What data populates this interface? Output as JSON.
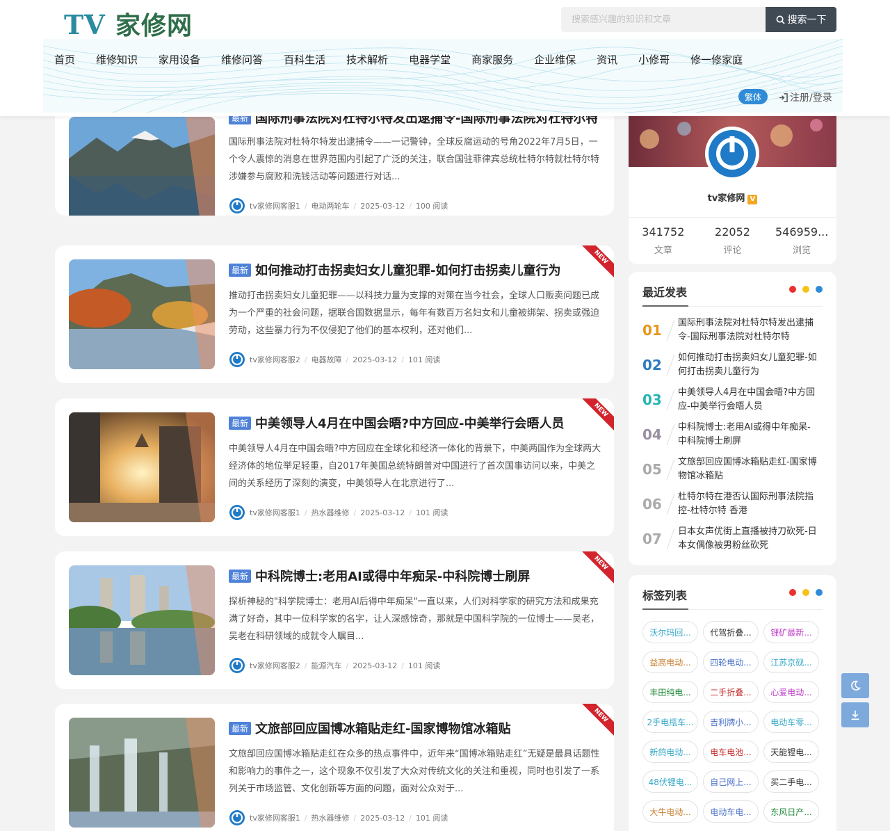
{
  "header": {
    "logo_a": "TV",
    "logo_b": "家修网",
    "search_placeholder": "搜索感兴趣的知识和文章",
    "search_button": "搜索一下",
    "nav": [
      "首页",
      "维修知识",
      "家用设备",
      "维修问答",
      "百科生活",
      "技术解析",
      "电器学堂",
      "商家服务",
      "企业维保",
      "资讯",
      "小修哥",
      "修一修家庭"
    ],
    "traditional": "繁体",
    "login": "注册/登录"
  },
  "articles": [
    {
      "badge": "最新",
      "title": "国际刑事法院对杜特尔特发出逮捕令-国际刑事法院对杜特尔特",
      "excerpt": "国际刑事法院对杜特尔特发出逮捕令——一记警钟，全球反腐运动的号角2022年7月5日，一个令人震惊的消息在世界范围内引起了广泛的关注，联合国驻菲律宾总统杜特尔特就杜特尔特涉嫌参与腐败和洗钱活动等问题进行对话...",
      "author": "tv家修网客服1",
      "category": "电动两轮车",
      "date": "2025-03-12",
      "views": "100 阅读",
      "ribbon": ""
    },
    {
      "badge": "最新",
      "title": "如何推动打击拐卖妇女儿童犯罪-如何打击拐卖儿童行为",
      "excerpt": "推动打击拐卖妇女儿童犯罪——以科技力量为支撑的对策在当今社会，全球人口贩卖问题已成为一个严重的社会问题，据联合国数据显示，每年有数百万名妇女和儿童被绑架、拐卖或强迫劳动，这些暴力行为不仅侵犯了他们的基本权利，还对他们...",
      "author": "tv家修网客服2",
      "category": "电器故障",
      "date": "2025-03-12",
      "views": "101 阅读",
      "ribbon": "NEW"
    },
    {
      "badge": "最新",
      "title": "中美领导人4月在中国会晤?中方回应-中美举行会晤人员",
      "excerpt": "中美领导人4月在中国会晤?中方回应在全球化和经济一体化的背景下，中美两国作为全球两大经济体的地位举足轻重，自2017年美国总统特朗普对中国进行了首次国事访问以来，中美之间的关系经历了深刻的演变，中美领导人在北京进行了...",
      "author": "tv家修网客服1",
      "category": "热水器维修",
      "date": "2025-03-12",
      "views": "101 阅读",
      "ribbon": "NEW"
    },
    {
      "badge": "最新",
      "title": "中科院博士:老用AI或得中年痴呆-中科院博士刷屏",
      "excerpt": "探析神秘的\"科学院博士：老用AI后得中年痴呆\"一直以来，人们对科学家的研究方法和成果充满了好奇，其中一位科学家的名字，让人深感惊奇，那就是中国科学院的一位博士——吴老，吴老在科研领域的成就令人瞩目...",
      "author": "tv家修网客服2",
      "category": "能源汽车",
      "date": "2025-03-12",
      "views": "101 阅读",
      "ribbon": "NEW"
    },
    {
      "badge": "最新",
      "title": "文旅部回应国博冰箱贴走红-国家博物馆冰箱贴",
      "excerpt": "文旅部回应国博冰箱贴走红在众多的热点事件中，近年来“国博冰箱贴走红”无疑是最具话题性和影响力的事件之一，这个现象不仅引发了大众对传统文化的关注和重视，同时也引发了一系列关于市场监管、文化创新等方面的问题，面对公众对于...",
      "author": "tv家修网客服1",
      "category": "热水器维修",
      "date": "2025-03-12",
      "views": "101 阅读",
      "ribbon": "NEW"
    }
  ],
  "profile": {
    "name": "tv家修网",
    "verified": "V",
    "stats": [
      {
        "value": "341752",
        "label": "文章"
      },
      {
        "value": "22052",
        "label": "评论"
      },
      {
        "value": "546959...",
        "label": "浏览"
      }
    ]
  },
  "recent": {
    "title": "最近发表",
    "items": [
      {
        "num": "01",
        "color": "#e8961a",
        "text": "国际刑事法院对杜特尔特发出逮捕令-国际刑事法院对杜特尔特"
      },
      {
        "num": "02",
        "color": "#2b7bc1",
        "text": "如何推动打击拐卖妇女儿童犯罪-如何打击拐卖儿童行为"
      },
      {
        "num": "03",
        "color": "#27b3b3",
        "text": "中美领导人4月在中国会晤?中方回应-中美举行会晤人员"
      },
      {
        "num": "04",
        "color": "#9a8fa0",
        "text": "中科院博士:老用AI或得中年痴呆-中科院博士刷屏"
      },
      {
        "num": "05",
        "color": "#aaaaaa",
        "text": "文旅部回应国博冰箱贴走红-国家博物馆冰箱贴"
      },
      {
        "num": "06",
        "color": "#aaaaaa",
        "text": "杜特尔特在港否认国际刑事法院指控-杜特尔特 香港"
      },
      {
        "num": "07",
        "color": "#aaaaaa",
        "text": "日本女声优街上直播被持刀砍死-日本女偶像被男粉丝砍死"
      }
    ]
  },
  "tags": {
    "title": "标签列表",
    "items": [
      {
        "text": "沃尔玛回...",
        "color": "#38a8c8"
      },
      {
        "text": "代驾折叠...",
        "color": "#333333"
      },
      {
        "text": "锂矿最新...",
        "color": "#c040c8"
      },
      {
        "text": "益高电动...",
        "color": "#c88030"
      },
      {
        "text": "四轮电动...",
        "color": "#4870c8"
      },
      {
        "text": "江苏京砚...",
        "color": "#38a8c8"
      },
      {
        "text": "丰田纯电...",
        "color": "#208838"
      },
      {
        "text": "二手折叠...",
        "color": "#c83030"
      },
      {
        "text": "心爱电动...",
        "color": "#c040c8"
      },
      {
        "text": "2手电瓶车...",
        "color": "#38a8c8"
      },
      {
        "text": "吉利牌小...",
        "color": "#4870c8"
      },
      {
        "text": "电动车零...",
        "color": "#38a8c8"
      },
      {
        "text": "新鸽电动...",
        "color": "#38a8c8"
      },
      {
        "text": "电车电池...",
        "color": "#c83030"
      },
      {
        "text": "天能锂电...",
        "color": "#333333"
      },
      {
        "text": "48伏锂电...",
        "color": "#38a8c8"
      },
      {
        "text": "自己网上...",
        "color": "#4870c8"
      },
      {
        "text": "买二手电...",
        "color": "#333333"
      },
      {
        "text": "大牛电动...",
        "color": "#c88030"
      },
      {
        "text": "电动车电...",
        "color": "#4870c8"
      },
      {
        "text": "东风日产...",
        "color": "#208838"
      }
    ]
  },
  "float_buttons": [
    "moon-icon",
    "download-icon"
  ]
}
